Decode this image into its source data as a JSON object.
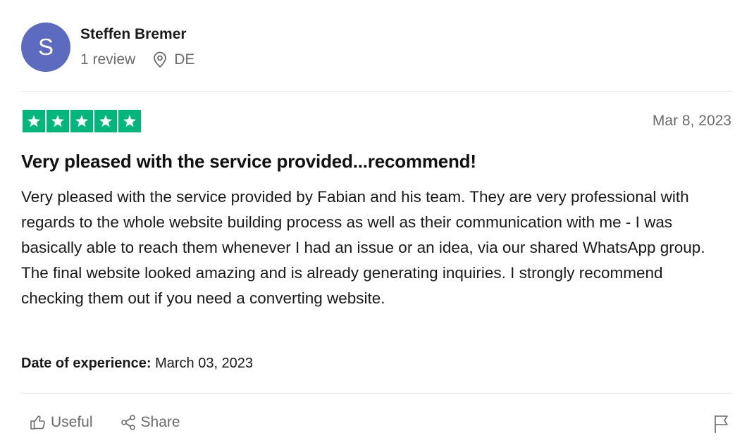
{
  "reviewer": {
    "initial": "S",
    "name": "Steffen Bremer",
    "review_count": "1 review",
    "country": "DE",
    "avatar_color": "#5c6bc0",
    "location_icon": "location-pin-icon"
  },
  "review": {
    "rating": 5,
    "rating_max": 5,
    "star_color": "#00b67a",
    "date": "Mar 8, 2023",
    "title": "Very pleased with the service provided...recommend!",
    "body": "Very pleased with the service provided by Fabian and his team. They are very professional with regards to the whole website building process as well as their communication with me - I was basically able to reach them whenever I had an issue or an idea, via our shared WhatsApp group. The final website looked amazing and is already generating inquiries. I strongly recommend checking them out if you need a converting website.",
    "experience_label": "Date of experience:",
    "experience_date": "March 03, 2023"
  },
  "actions": {
    "useful_label": "Useful",
    "useful_icon": "thumbs-up-icon",
    "share_label": "Share",
    "share_icon": "share-icon",
    "report_icon": "flag-icon"
  }
}
